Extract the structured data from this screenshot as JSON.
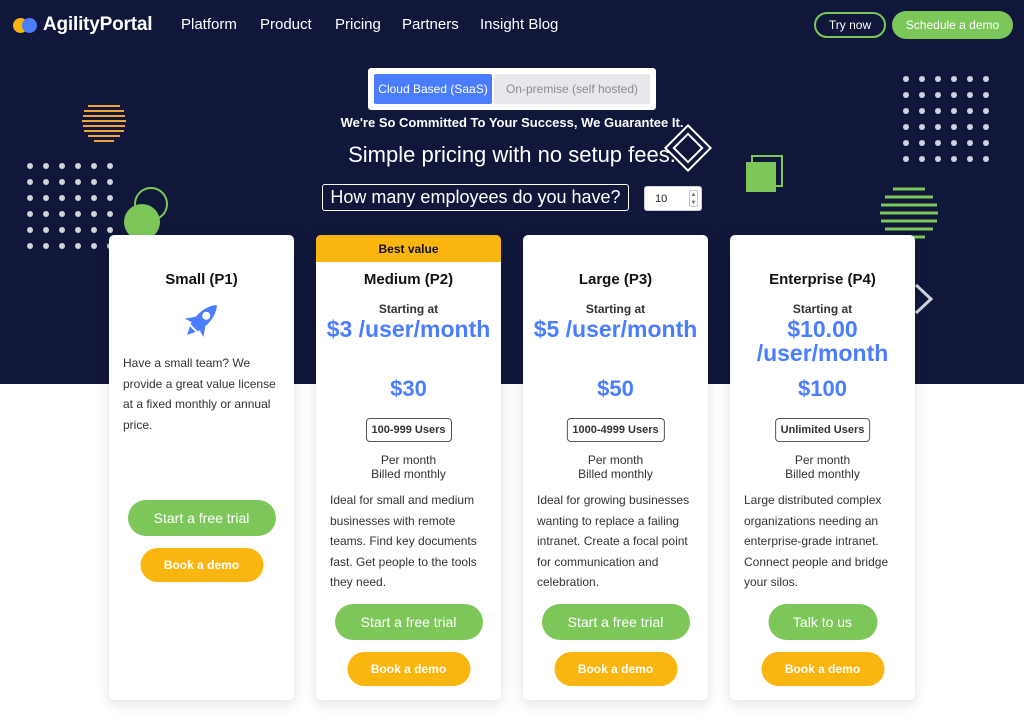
{
  "brand": {
    "name": "AgilityPortal"
  },
  "nav": {
    "links": [
      "Platform",
      "Product",
      "Pricing",
      "Partners",
      "Insight Blog"
    ],
    "try_now": "Try now",
    "schedule_demo": "Schedule a demo"
  },
  "hosting_toggle": {
    "options": [
      "Cloud Based (SaaS)",
      "On-premise (self hosted)"
    ],
    "selected": "Cloud Based (SaaS)"
  },
  "hero": {
    "guarantee": "We're So Committed To Your Success, We Guarantee It.",
    "headline": "Simple pricing with no setup fees.",
    "employees_question": "How many employees do you have?",
    "employees_value": "10"
  },
  "plans": [
    {
      "title": "Small (P1)",
      "icon": "rocket-icon",
      "description": "Have a small team? We provide a great value license at a fixed monthly or annual price.",
      "trial_label": "Start a free trial",
      "demo_label": "Book a demo"
    },
    {
      "banner": "Best value",
      "title": "Medium (P2)",
      "starting_at": "Starting at",
      "price": "$3 /user/month",
      "total": "$30",
      "users": "100-999 Users",
      "per_month": "Per month",
      "billed": "Billed monthly",
      "description": "Ideal for small and medium businesses with remote teams. Find key documents fast. Get people to the tools they need.",
      "trial_label": "Start a free trial",
      "demo_label": "Book a demo"
    },
    {
      "title": "Large (P3)",
      "starting_at": "Starting at",
      "price": "$5 /user/month",
      "total": "$50",
      "users": "1000-4999 Users",
      "per_month": "Per month",
      "billed": "Billed monthly",
      "description": "Ideal for growing businesses wanting to replace a failing intranet. Create a focal point for communication and celebration.",
      "trial_label": "Start a free trial",
      "demo_label": "Book a demo"
    },
    {
      "title": "Enterprise (P4)",
      "starting_at": "Starting at",
      "price": "$10.00 /user/month",
      "total": "$100",
      "users": "Unlimited Users",
      "per_month": "Per month",
      "billed": "Billed monthly",
      "description": "Large distributed complex organizations needing an enterprise-grade intranet. Connect people and bridge your silos.",
      "trial_label": "Talk to us",
      "demo_label": "Book a demo"
    }
  ],
  "colors": {
    "hero_bg": "#10173a",
    "accent_blue": "#4a7dff",
    "green": "#7dc75a",
    "yellow": "#fbb50f"
  }
}
